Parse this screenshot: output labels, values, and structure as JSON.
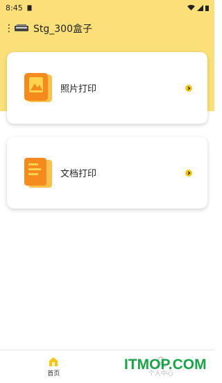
{
  "status_bar": {
    "time": "8:45"
  },
  "toolbar": {
    "device_name": "Stg_300盒子"
  },
  "cards": [
    {
      "label": "照片打印"
    },
    {
      "label": "文档打印"
    }
  ],
  "bottom_nav": [
    {
      "label": "首页",
      "active": true
    },
    {
      "label": "个人中心",
      "active": false
    }
  ],
  "watermark": "ITMOP.COM",
  "colors": {
    "accent": "#fbe07a",
    "icon_orange": "#f59b1a",
    "chevron": "#f5c518"
  }
}
